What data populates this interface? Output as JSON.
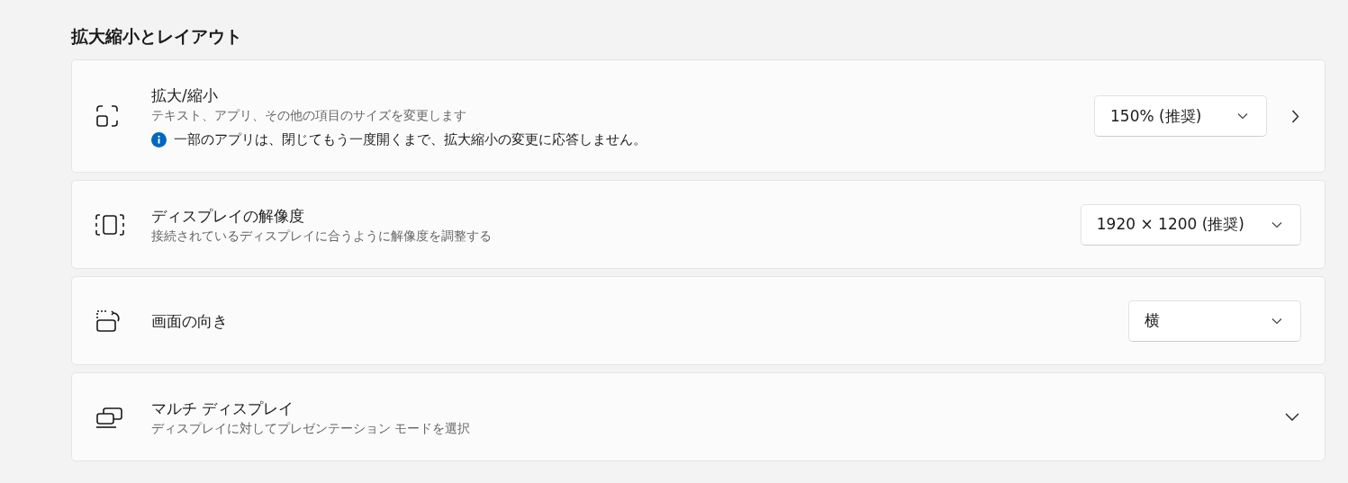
{
  "section_title": "拡大縮小とレイアウト",
  "settings": [
    {
      "kind": "scale",
      "title": "拡大/縮小",
      "description": "テキスト、アプリ、その他の項目のサイズを変更します",
      "note": "一部のアプリは、閉じてもう一度開くまで、拡大縮小の変更に応答しません。",
      "dropdown": {
        "value": "150% (推奨)"
      },
      "navigate": true
    },
    {
      "kind": "resolution",
      "title": "ディスプレイの解像度",
      "description": "接続されているディスプレイに合うように解像度を調整する",
      "dropdown": {
        "value": "1920 × 1200 (推奨)"
      }
    },
    {
      "kind": "orientation",
      "title": "画面の向き",
      "dropdown": {
        "value": "横"
      }
    },
    {
      "kind": "multi_display",
      "title": "マルチ ディスプレイ",
      "description": "ディスプレイに対してプレゼンテーション モードを選択",
      "expanded": false
    }
  ]
}
